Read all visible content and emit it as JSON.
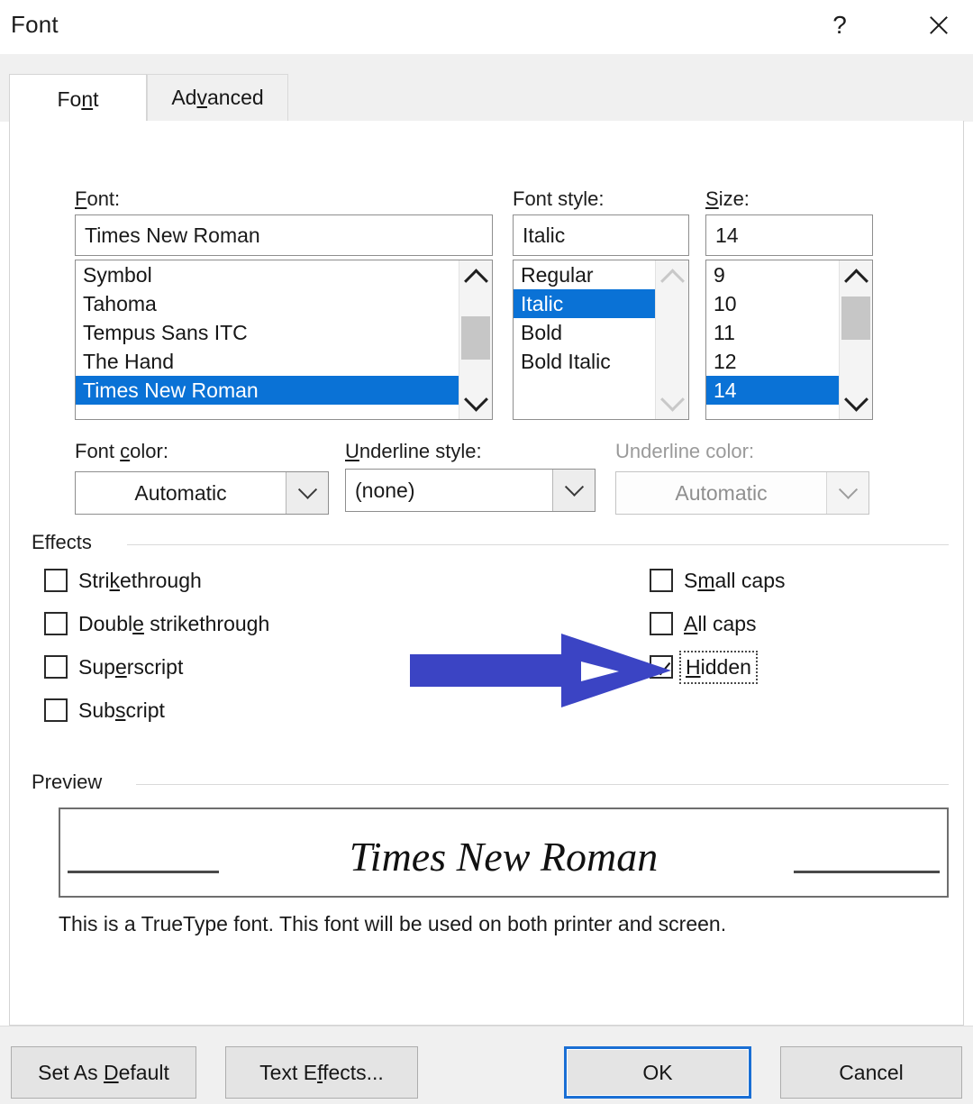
{
  "window": {
    "title": "Font",
    "help_icon": "question-mark-icon",
    "close_icon": "close-x-icon"
  },
  "tabs": [
    {
      "label": "Font",
      "accel_index": 2,
      "active": true
    },
    {
      "label": "Advanced",
      "accel_index": 3,
      "active": false
    }
  ],
  "font_section": {
    "font": {
      "label": "Font:",
      "value": "Times New Roman",
      "items": [
        "Symbol",
        "Tahoma",
        "Tempus Sans ITC",
        "The Hand",
        "Times New Roman"
      ],
      "selected": "Times New Roman",
      "scrollbar": {
        "up_icon": "chevron-up-icon",
        "down_icon": "chevron-down-icon",
        "enabled": true
      }
    },
    "font_style": {
      "label": "Font style:",
      "value": "Italic",
      "items": [
        "Regular",
        "Italic",
        "Bold",
        "Bold Italic"
      ],
      "selected": "Italic",
      "scrollbar": {
        "up_icon": "chevron-up-icon",
        "down_icon": "chevron-down-icon",
        "enabled": false
      }
    },
    "size": {
      "label": "Size:",
      "value": "14",
      "items": [
        "9",
        "10",
        "11",
        "12",
        "14"
      ],
      "selected": "14",
      "scrollbar": {
        "up_icon": "chevron-up-icon",
        "down_icon": "chevron-down-icon",
        "enabled": true
      }
    }
  },
  "color_row": {
    "font_color": {
      "label": "Font color:",
      "value": "Automatic",
      "disabled": false
    },
    "underline_style": {
      "label": "Underline style:",
      "value": "(none)",
      "disabled": false
    },
    "underline_color": {
      "label": "Underline color:",
      "value": "Automatic",
      "disabled": true
    }
  },
  "effects": {
    "group_label": "Effects",
    "left": [
      {
        "label": "Strikethrough",
        "checked": false
      },
      {
        "label": "Double strikethrough",
        "checked": false
      },
      {
        "label": "Superscript",
        "checked": false
      },
      {
        "label": "Subscript",
        "checked": false
      }
    ],
    "right": [
      {
        "label": "Small caps",
        "checked": false
      },
      {
        "label": "All caps",
        "checked": false
      },
      {
        "label": "Hidden",
        "checked": true,
        "focused": true
      }
    ]
  },
  "preview": {
    "group_label": "Preview",
    "sample_text": "Times New Roman",
    "note": "This is a TrueType font. This font will be used on both printer and screen."
  },
  "annotation": {
    "arrow_icon": "right-arrow-annotation",
    "color": "#3b44c4"
  },
  "footer": {
    "set_as_default": "Set As Default",
    "text_effects": "Text Effects...",
    "ok": "OK",
    "cancel": "Cancel"
  },
  "colors": {
    "selection_blue": "#0a72d6",
    "focus_border": "#1a6fd4",
    "panel_bg": "#ffffff",
    "chrome_bg": "#f0f0f0",
    "arrow_blue": "#3b44c4"
  }
}
